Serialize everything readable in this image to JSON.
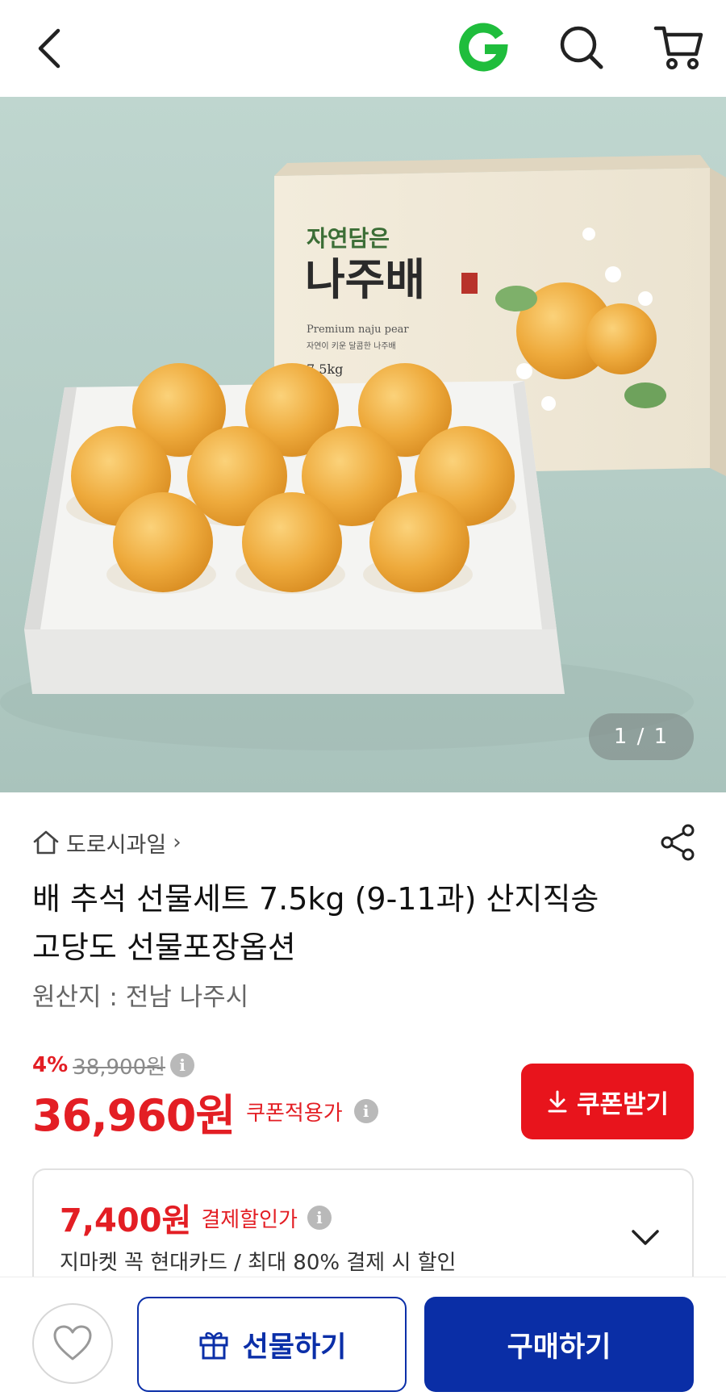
{
  "header": {
    "back_icon": "chevron-left-icon",
    "logo_letter": "G",
    "search_icon": "search-icon",
    "cart_icon": "cart-icon"
  },
  "hero": {
    "pager": "1 / 1",
    "box_brand_small": "자연담은",
    "box_brand_large": "나주배",
    "box_subtitle": "Premium naju pear",
    "box_tagline": "자연이 키운 달콤한 나주배",
    "box_weight": "7.5kg"
  },
  "seller": {
    "name": "도로시과일",
    "chevron": "›"
  },
  "product": {
    "title": "배 추석 선물세트 7.5kg (9-11과) 산지직송 고당도 선물포장옵션",
    "origin": "원산지 : 전남 나주시"
  },
  "price": {
    "discount_rate": "4%",
    "original": "38,900원",
    "sale": "36,960원",
    "coupon_applied_label": "쿠폰적용가",
    "info_glyph": "i"
  },
  "coupon_button": {
    "label": "쿠폰받기"
  },
  "card_discount": {
    "price": "7,400원",
    "label": "결제할인가",
    "description": "지마켓 꼭 현대카드 / 최대 80% 결제 시 할인"
  },
  "bottom": {
    "gift_label": "선물하기",
    "buy_label": "구매하기"
  },
  "colors": {
    "accent_red": "#e31e24",
    "brand_blue": "#0a2ea6",
    "logo_green": "#1fbd3c"
  }
}
